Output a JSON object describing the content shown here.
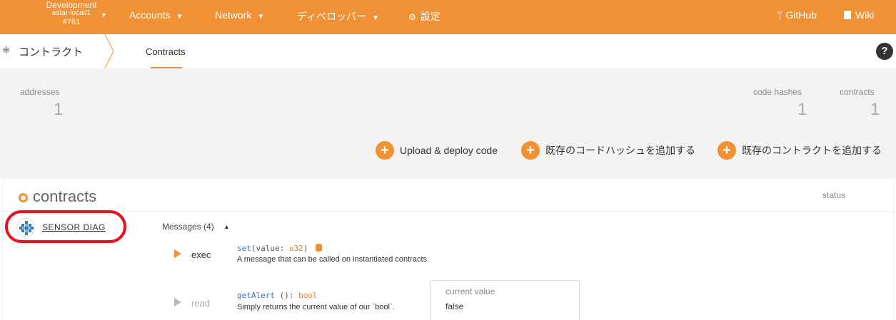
{
  "topbar": {
    "chain_name": "Development",
    "chain_node": "astar-local/1",
    "chain_block": "#761",
    "nav": [
      {
        "label": "Accounts",
        "icon": "chevron-down"
      },
      {
        "label": "Network",
        "icon": "chevron-down"
      },
      {
        "label": "ディベロッパー",
        "icon": "chevron-down"
      },
      {
        "label": "設定",
        "icon": "gears"
      }
    ],
    "github": "GitHub",
    "wiki": "Wiki",
    "color": "#f19135"
  },
  "subbar": {
    "title": "コントラクト",
    "tab": "Contracts",
    "help": "?"
  },
  "summary": {
    "addresses_label": "addresses",
    "addresses_value": "1",
    "code_hashes_label": "code hashes",
    "code_hashes_value": "1",
    "contracts_label": "contracts",
    "contracts_value": "1"
  },
  "actions": [
    {
      "label": "Upload & deploy code"
    },
    {
      "label": "既存のコードハッシュを追加する"
    },
    {
      "label": "既存のコントラクトを追加する"
    }
  ],
  "contracts": {
    "title": "contracts",
    "status_header": "status",
    "item": {
      "name": "SENSOR DIAG",
      "messages_label": "Messages (4)",
      "messages": [
        {
          "type": "exec",
          "fn": "set",
          "args": "(value: ",
          "arg_type": "u32",
          "close": ")",
          "description": "A message that can be called on instantiated contracts."
        },
        {
          "type": "read",
          "fn": "getAlert",
          "args": " (): ",
          "arg_type": "bool",
          "close": "",
          "description": "Simply returns the current value of our `bool`.",
          "current_value_label": "current value",
          "current_value": "false"
        }
      ]
    }
  }
}
